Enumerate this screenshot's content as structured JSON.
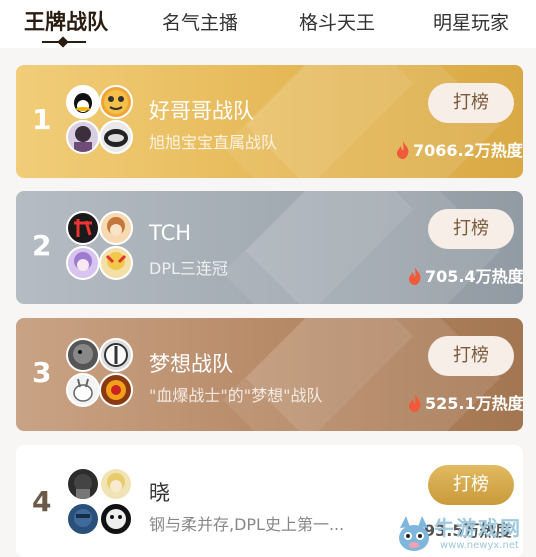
{
  "tabs": [
    {
      "label": "王牌战队",
      "active": true
    },
    {
      "label": "名气主播",
      "active": false
    },
    {
      "label": "格斗天王",
      "active": false
    },
    {
      "label": "明星玩家",
      "active": false
    }
  ],
  "teams": [
    {
      "rank": "1",
      "name": "好哥哥战队",
      "subtitle": "旭旭宝宝直属战队",
      "heat": "7066.2万热度",
      "button": "打榜"
    },
    {
      "rank": "2",
      "name": "TCH",
      "subtitle": "DPL三连冠",
      "heat": "705.4万热度",
      "button": "打榜"
    },
    {
      "rank": "3",
      "name": "梦想战队",
      "subtitle": "\"血爆战士\"的\"梦想\"战队",
      "heat": "525.1万热度",
      "button": "打榜"
    },
    {
      "rank": "4",
      "name": "晓",
      "subtitle": "钢与柔并存,DPL史上第一...",
      "heat": "93.5万热度",
      "button": "打榜"
    }
  ],
  "colors": {
    "gold": "#e5b65a",
    "silver": "#a2aab2",
    "bronze": "#b98a64",
    "button_gold": "#d4a84c",
    "flame": "#f05a3a"
  },
  "watermark": {
    "text": "牛游戏网",
    "url": "www.newyx.net"
  }
}
